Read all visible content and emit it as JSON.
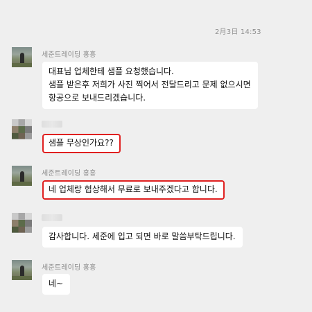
{
  "timestamp": "2月3日 14:53",
  "messages": [
    {
      "sender": "세준트레이딩 홍흥",
      "lines": [
        "대표님 업체한테 샘플 요청했습니다.",
        "샘플 받은후 저희가 사진 찍어서 전달드리고 문제 없으시면",
        "항공으로 보내드리겠습니다."
      ],
      "highlighted": false
    },
    {
      "sender": "",
      "lines": [
        "샘플 무상인가요??"
      ],
      "highlighted": true
    },
    {
      "sender": "세준트레이딩 홍흥",
      "lines": [
        "네 업체랑 협상해서 무료로 보내주겠다고 합니다."
      ],
      "highlighted": true
    },
    {
      "sender": "",
      "lines": [
        "감사합니다. 세준에 입고 되면 바로 말씀부탁드립니다."
      ],
      "highlighted": false
    },
    {
      "sender": "세준트레이딩 홍흥",
      "lines": [
        "네~"
      ],
      "highlighted": false
    }
  ],
  "colors": {
    "background": "#efefef",
    "bubble": "#ffffff",
    "highlight_border": "#e02020",
    "meta_text": "#8a8a8a"
  }
}
